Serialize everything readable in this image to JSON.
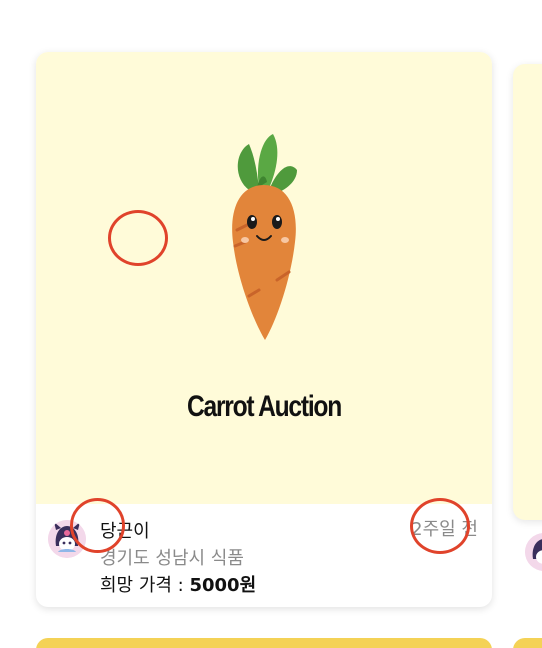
{
  "product_card": {
    "image_alt": "Carrot Auction",
    "logo_text": "Carrot Auction",
    "seller_name": "당근이",
    "location": "경기도 성남시 식품",
    "price_label": "희망 가격 : ",
    "price_value": "5000원",
    "time_ago": "2주일 전"
  },
  "colors": {
    "card_image_bg": "#fffbd9",
    "carrot_orange": "#e2853a",
    "leaf_green": "#4f9a3c",
    "marker_red": "#e0432b",
    "next_card_yellow": "#f4d256"
  },
  "icons": {
    "avatar": "kuromi-avatar-icon",
    "carrot": "carrot-mascot-icon"
  }
}
